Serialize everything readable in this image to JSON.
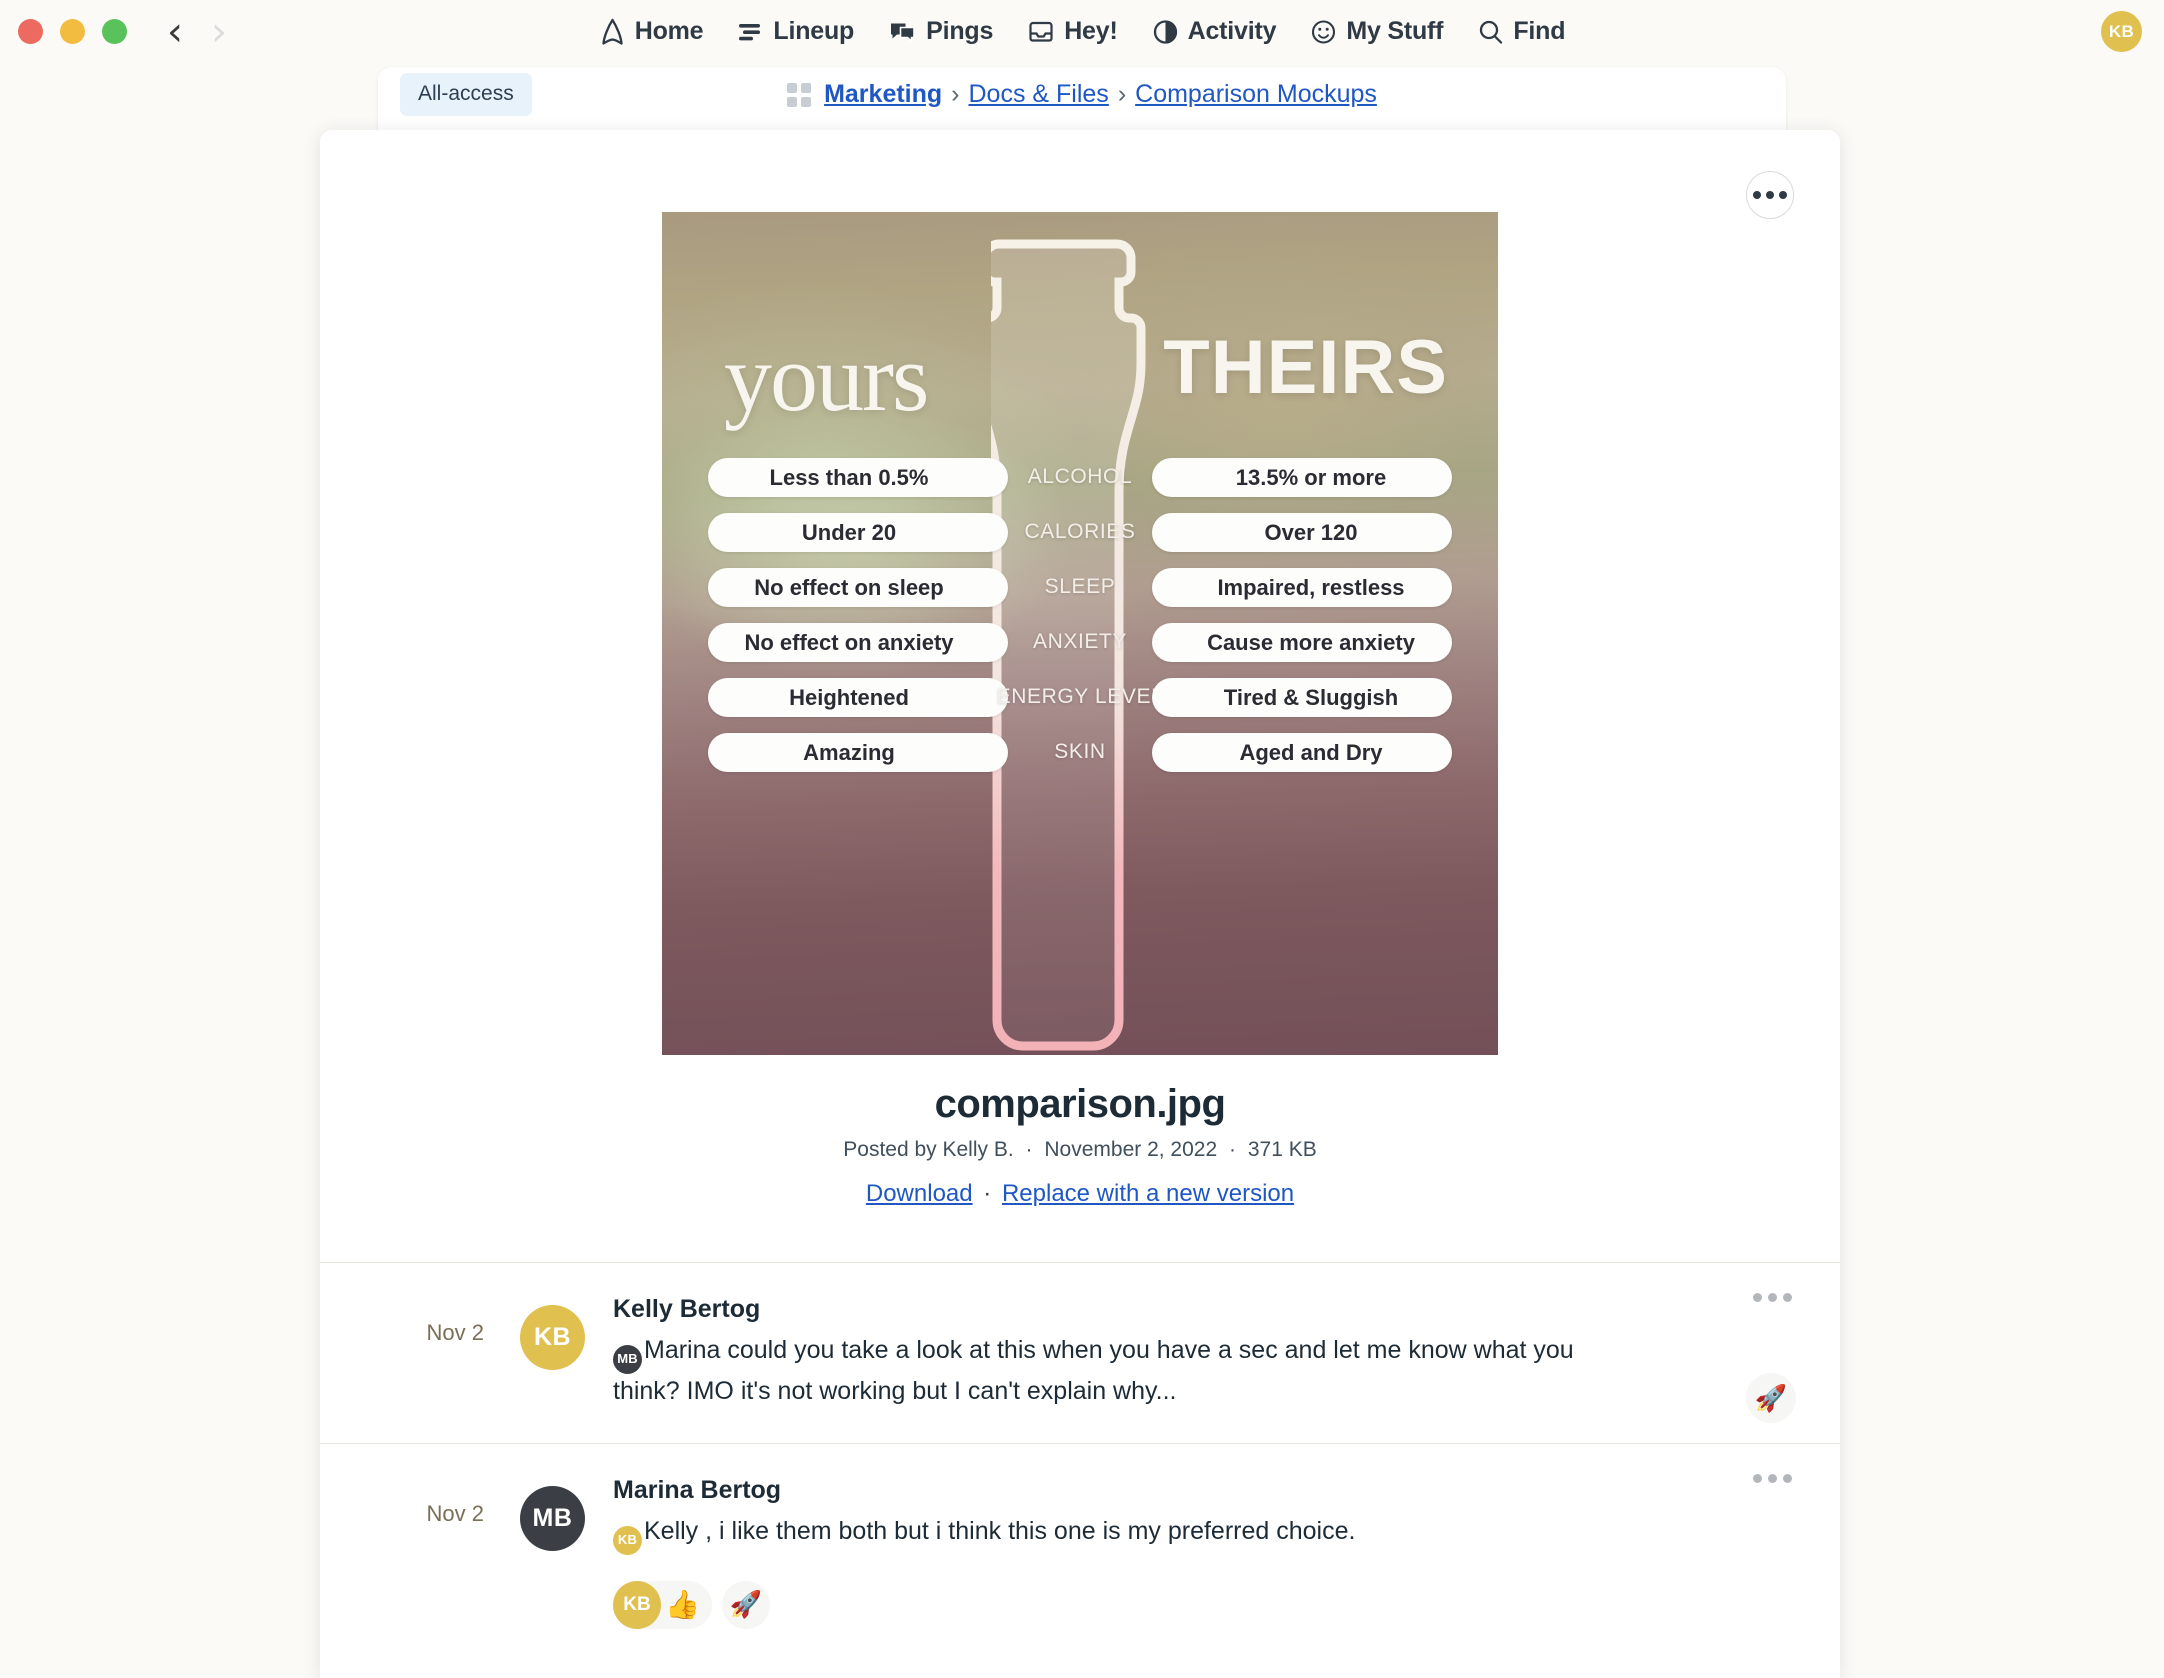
{
  "window": {
    "traffic_lights": [
      "close",
      "minimize",
      "maximize"
    ],
    "back_label": "‹",
    "forward_label": "›"
  },
  "globalnav": {
    "items": [
      {
        "label": "Home",
        "icon": "home-icon"
      },
      {
        "label": "Lineup",
        "icon": "lineup-icon"
      },
      {
        "label": "Pings",
        "icon": "pings-icon"
      },
      {
        "label": "Hey!",
        "icon": "hey-inbox-icon"
      },
      {
        "label": "Activity",
        "icon": "activity-icon"
      },
      {
        "label": "My Stuff",
        "icon": "my-stuff-icon"
      },
      {
        "label": "Find",
        "icon": "search-icon"
      }
    ],
    "account_initials": "KB"
  },
  "project": {
    "badge": "All-access",
    "breadcrumb": [
      {
        "label": "Marketing",
        "strong": true
      },
      {
        "label": "Docs & Files",
        "strong": false
      },
      {
        "label": "Comparison Mockups",
        "strong": false
      }
    ],
    "separator": "›"
  },
  "card": {
    "menu_icon": "ellipsis-icon"
  },
  "attachment": {
    "filename": "comparison.jpg",
    "posted_by": "Posted by Kelly B.",
    "date": "November 2, 2022",
    "size": "371 KB",
    "meta_separator": "·",
    "download_label": "Download",
    "replace_label": "Replace with a new version",
    "action_separator": "·"
  },
  "poster": {
    "left_heading": "yours",
    "right_heading": "THEIRS",
    "rows": [
      {
        "label": "ALCOHOL",
        "left": "Less than 0.5%",
        "right": "13.5% or more"
      },
      {
        "label": "CALORIES",
        "left": "Under 20",
        "right": "Over 120"
      },
      {
        "label": "SLEEP",
        "left": "No effect on sleep",
        "right": "Impaired, restless"
      },
      {
        "label": "ANXIETY",
        "left": "No effect on anxiety",
        "right": "Cause more anxiety"
      },
      {
        "label": "ENERGY LEVEL",
        "left": "Heightened",
        "right": "Tired & Sluggish"
      },
      {
        "label": "SKIN",
        "left": "Amazing",
        "right": "Aged and Dry"
      }
    ]
  },
  "comments": [
    {
      "date": "Nov 2",
      "author": "Kelly Bertog",
      "avatar_initials": "KB",
      "avatar_color": "#e0c04e",
      "mention_initials": "MB",
      "mention_color": "#3b3f45",
      "text": "Marina could you take a look at this when you have a sec and let me know what you think? IMO it's not working but I can't explain why...",
      "menu_icon": "ellipsis-icon",
      "add_reaction_icon": "rocket-add-icon",
      "add_reaction_emoji": "🚀",
      "reactions": []
    },
    {
      "date": "Nov 2",
      "author": "Marina Bertog",
      "avatar_initials": "MB",
      "avatar_color": "#3b3f45",
      "mention_initials": "KB",
      "mention_color": "#e0c04e",
      "text": "Kelly , i like them both but i think this one is my preferred choice.",
      "menu_icon": "ellipsis-icon",
      "add_reaction_icon": "rocket-add-icon",
      "add_reaction_emoji": "🚀",
      "reactions": [
        {
          "initials": "KB",
          "emoji": "👍"
        }
      ]
    }
  ],
  "colors": {
    "page_bg": "#fbfaf7",
    "link": "#1f57c3",
    "accent_yellow": "#e0c04e",
    "badge_bg": "#e7f2fb",
    "text": "#1d2b36"
  }
}
